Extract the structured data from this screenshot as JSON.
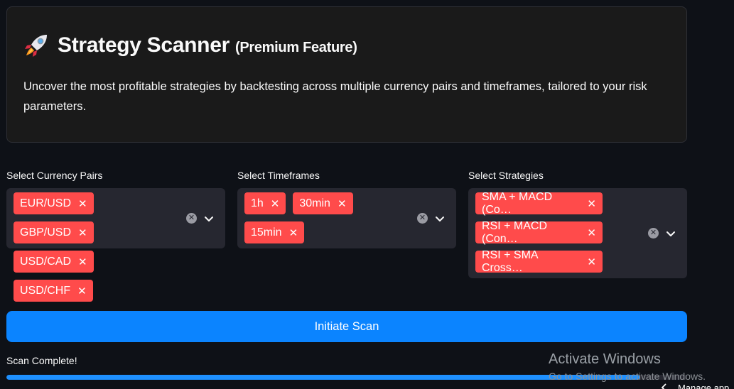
{
  "hero": {
    "title": "Strategy Scanner",
    "subtitle": "(Premium Feature)",
    "description": "Uncover the most profitable strategies by backtesting across multiple currency pairs and timeframes, tailored to your risk parameters."
  },
  "fields": {
    "currency": {
      "label": "Select Currency Pairs",
      "tags": [
        "EUR/USD",
        "GBP/USD",
        "USD/CAD",
        "USD/CHF"
      ]
    },
    "timeframes": {
      "label": "Select Timeframes",
      "tags": [
        "1h",
        "30min",
        "15min"
      ]
    },
    "strategies": {
      "label": "Select Strategies",
      "tags": [
        "SMA + MACD (Co…",
        "RSI + MACD (Con…",
        "RSI + SMA Cross…"
      ]
    }
  },
  "action": {
    "scan_label": "Initiate Scan"
  },
  "status": {
    "text": "Scan Complete!",
    "progress": 0.93
  },
  "watermark": {
    "title": "Activate Windows",
    "subtitle": "Go to Settings to activate Windows."
  },
  "taskbar": {
    "text": "Manage app"
  },
  "colors": {
    "accent": "#ff4b4b",
    "button": "#0b84ff",
    "progress": "#1e90ff"
  },
  "icons": {
    "title": "rocket-icon",
    "tag_remove": "close-icon",
    "clear": "clear-icon",
    "dropdown": "chevron-down-icon"
  }
}
